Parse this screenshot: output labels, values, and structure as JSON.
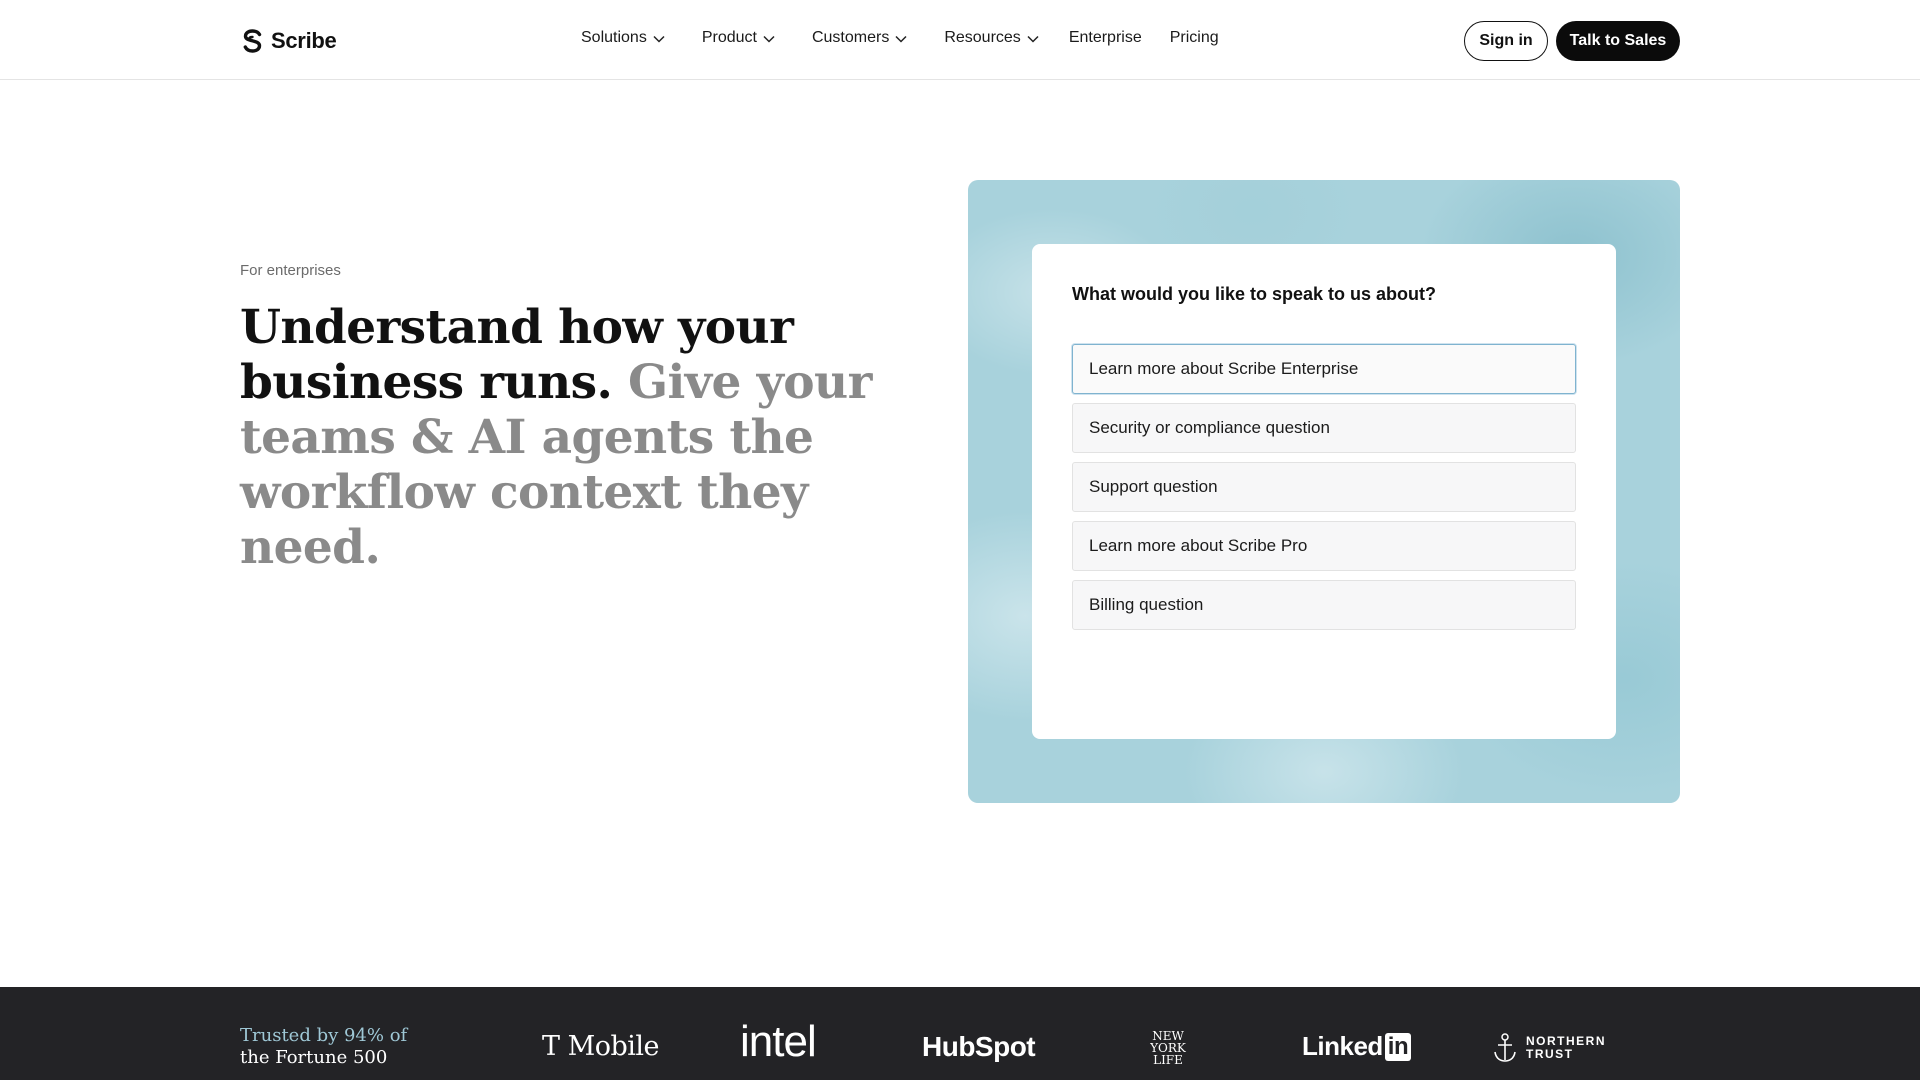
{
  "brand": {
    "name": "Scribe",
    "logo_icon": "scribe-s-logo"
  },
  "nav": {
    "items": [
      {
        "label": "Solutions",
        "has_dropdown": true
      },
      {
        "label": "Product",
        "has_dropdown": true
      },
      {
        "label": "Customers",
        "has_dropdown": true
      },
      {
        "label": "Resources",
        "has_dropdown": true
      },
      {
        "label": "Enterprise",
        "has_dropdown": false
      },
      {
        "label": "Pricing",
        "has_dropdown": false
      }
    ],
    "sign_in": "Sign in",
    "talk_to_sales": "Talk to Sales"
  },
  "hero": {
    "eyebrow": "For enterprises",
    "headline_primary": "Understand how your business runs.",
    "headline_secondary": "Give your teams & AI agents the workflow context they need."
  },
  "form": {
    "question": "What would you like to speak to us about?",
    "options": [
      "Learn more about Scribe Enterprise",
      "Security or compliance question",
      "Support question",
      "Learn more about Scribe Pro",
      "Billing question"
    ],
    "selected_index": 0
  },
  "trusted": {
    "line1": "Trusted by 94% of",
    "line2": "the Fortune 500",
    "logos": {
      "tmobile": "T Mobile",
      "intel": "intel",
      "hubspot": "HubSpot",
      "nyl": [
        "NEW",
        "YORK",
        "LIFE"
      ],
      "linkedin_text": "Linked",
      "linkedin_badge": "in",
      "northern_trust": [
        "NORTHERN",
        "TRUST"
      ]
    }
  },
  "colors": {
    "accent_dark": "#0b0b0b",
    "panel_blue": "#a8d2dc",
    "strip_bg": "#232326",
    "trusted_accent": "#9fc8d6",
    "headline_muted": "#8a8a8a"
  }
}
